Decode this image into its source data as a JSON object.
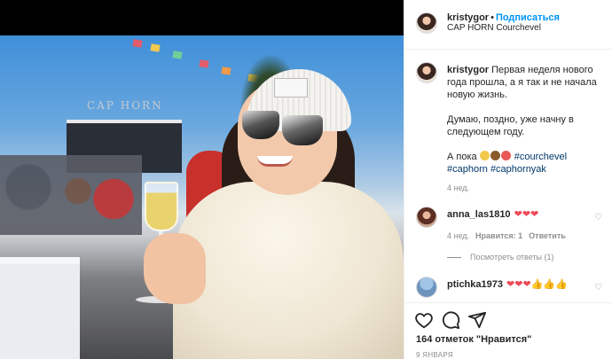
{
  "post": {
    "author": "kristygor",
    "follow_label": "Подписаться",
    "location": "CAP HORN Courchevel",
    "tent_sign": "CAP HORN",
    "caption": {
      "line1": "Первая неделя нового года прошла, а я так и не начала новую жизнь.",
      "line2": "Думаю, поздно, уже начну в следующем году.",
      "line3_prefix": "А пока",
      "hashtags": [
        "#courchevel",
        "#caphorn",
        "#caphornyak"
      ],
      "time": "4 нед."
    },
    "comments": [
      {
        "user": "anna_las1810",
        "text": "❤❤❤",
        "time": "4 нед.",
        "likes_label": "Нравится: 1",
        "reply_label": "Ответить",
        "view_replies": "Посмотреть ответы (1)"
      },
      {
        "user": "ptichka1973",
        "text": "❤❤❤👍👍👍"
      }
    ],
    "likes_text": "164 отметок \"Нравится\"",
    "date": "9 ЯНВАРЯ"
  },
  "colors": {
    "accent": "#0095f6",
    "hashtag": "#00376b",
    "heart": "#ed4956",
    "muted": "#8e8e8e"
  },
  "icons": [
    "heart-icon",
    "comment-icon",
    "share-icon"
  ]
}
